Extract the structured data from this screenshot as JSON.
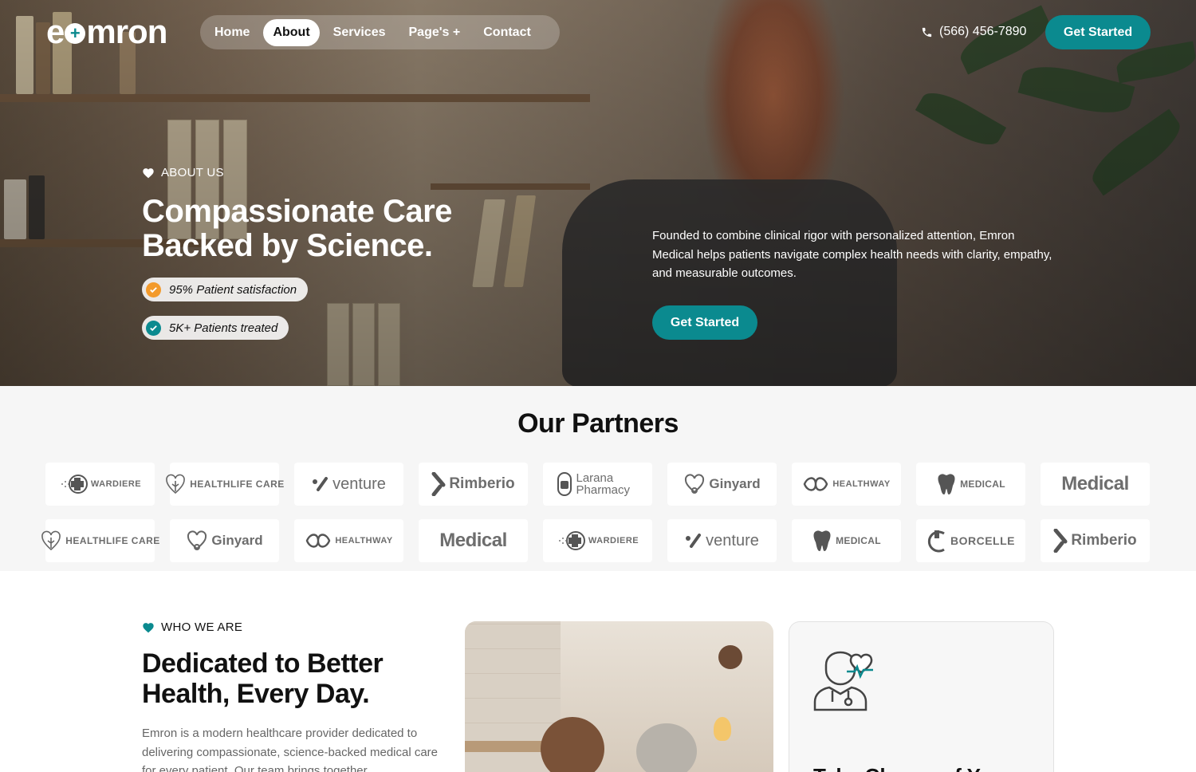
{
  "brand": {
    "logo_pre": "e",
    "logo_post": "mron"
  },
  "nav": {
    "items": [
      {
        "label": "Home"
      },
      {
        "label": "About"
      },
      {
        "label": "Services"
      },
      {
        "label": "Page's +"
      },
      {
        "label": "Contact"
      }
    ],
    "active": "About"
  },
  "header": {
    "phone": "(566) 456-7890",
    "cta": "Get Started"
  },
  "hero": {
    "eyebrow": "ABOUT US",
    "title_line1": "Compassionate Care",
    "title_line2": "Backed by Science.",
    "badges": [
      {
        "text": "95% Patient satisfaction",
        "color": "#f39a2b"
      },
      {
        "text": "5K+ Patients treated",
        "color": "#0b8a8f"
      }
    ],
    "description": "Founded to combine clinical rigor with personalized attention, Emron Medical helps patients navigate complex health needs with clarity, empathy, and measurable outcomes.",
    "cta": "Get Started"
  },
  "partners": {
    "title": "Our Partners",
    "row1": [
      "WARDIERE",
      "HEALTHLIFE CARE",
      "venture",
      "Rimberio",
      "Larana Pharmacy",
      "Ginyard",
      "HEALTHWAY",
      "MEDICAL",
      "Medical"
    ],
    "row2": [
      "HEALTHLIFE CARE",
      "Ginyard",
      "HEALTHWAY",
      "Medical",
      "WARDIERE",
      "venture",
      "MEDICAL",
      "BORCELLE",
      "Rimberio"
    ]
  },
  "who": {
    "eyebrow": "WHO WE ARE",
    "title_line1": "Dedicated to Better",
    "title_line2": "Health, Every Day.",
    "description": "Emron is a modern healthcare provider dedicated to delivering compassionate, science-backed medical care for every patient. Our team brings together",
    "card_heading": "Take Charge of Your"
  },
  "colors": {
    "accent": "#0b8a8f",
    "orange": "#f39a2b"
  }
}
